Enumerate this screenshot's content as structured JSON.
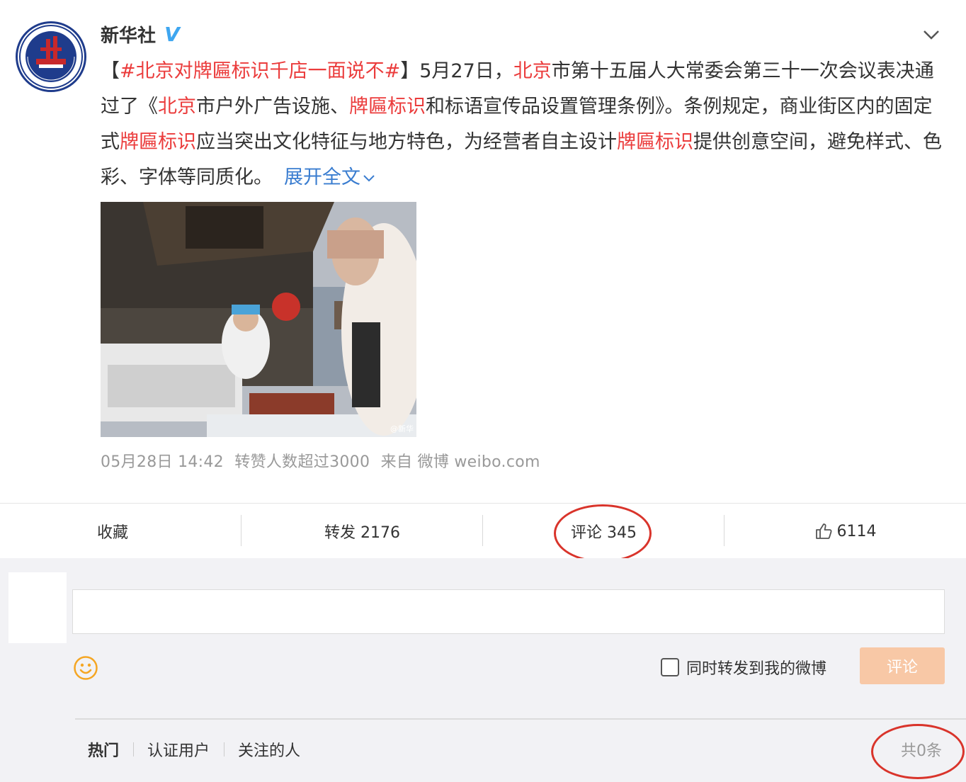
{
  "post": {
    "author": "新华社",
    "verified_badge": "V",
    "content": {
      "open_bracket": "【",
      "hashtag": "#北京对牌匾标识千店一面说不#",
      "close_bracket": "】",
      "t1": "5月27日，",
      "kw_beijing_1": "北京",
      "t2": "市第十五届人大常委会第三十一次会议表决通过了《",
      "kw_beijing_2": "北京",
      "t3": "市户外广告设施、",
      "kw_sign_1": "牌匾标识",
      "t4": "和标语宣传品设置管理条例》。条例规定，商业街区内的固定式",
      "kw_sign_2": "牌匾标识",
      "t5": "应当突出文化特征与地方特色，为经营者自主设计",
      "kw_sign_3": "牌匾标识",
      "t6": "提供创意空间，避免样式、色彩、字体等同质化。",
      "expand": "展开全文"
    },
    "photo_watermark": "@新华",
    "meta": {
      "time": "05月28日 14:42",
      "popularity": "转赞人数超过3000",
      "source": "来自 微博 weibo.com"
    }
  },
  "actions": {
    "favorite": "收藏",
    "repost": "转发 2176",
    "comment": "评论 345",
    "like_count": "6114"
  },
  "comment_box": {
    "input_value": "",
    "repost_checkbox_label": "同时转发到我的微博",
    "submit_label": "评论"
  },
  "comment_tabs": [
    "热门",
    "认证用户",
    "关注的人"
  ],
  "comment_total": "共0条",
  "colors": {
    "keyword_red": "#eb3c3c",
    "link_blue": "#3a7dd0",
    "annotation_circle": "#d9342b",
    "submit_disabled": "#f8c8a6"
  }
}
